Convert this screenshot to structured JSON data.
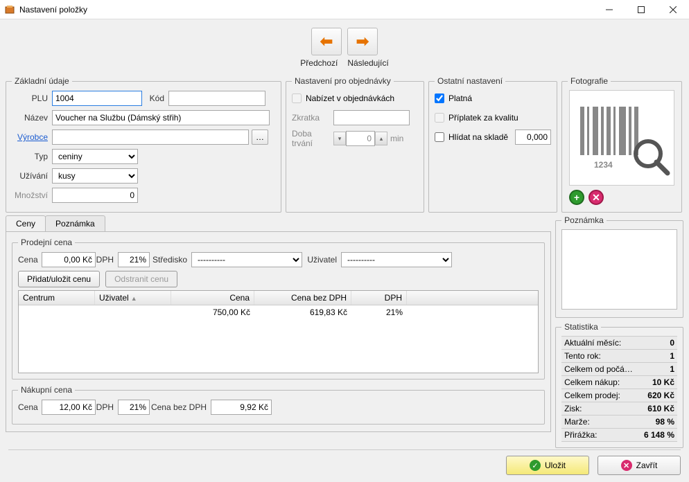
{
  "window": {
    "title": "Nastavení položky"
  },
  "toolbar": {
    "prev": "Předchozí",
    "next": "Následující"
  },
  "basic": {
    "legend": "Základní údaje",
    "plu_label": "PLU",
    "plu_value": "1004",
    "kod_label": "Kód",
    "kod_value": "",
    "nazev_label": "Název",
    "nazev_value": "Voucher na Službu (Dámský střih)",
    "vyrobce_label": "Výrobce",
    "vyrobce_value": "",
    "typ_label": "Typ",
    "typ_value": "ceniny",
    "uzivani_label": "Užívání",
    "uzivani_value": "kusy",
    "mnozstvi_label": "Množství",
    "mnozstvi_value": "0"
  },
  "orders": {
    "legend": "Nastavení pro objednávky",
    "nabizet_label": "Nabízet v objednávkách",
    "zkratka_label": "Zkratka",
    "zkratka_value": "",
    "doba_label": "Doba trvání",
    "doba_value": "0",
    "doba_unit": "min"
  },
  "other": {
    "legend": "Ostatní nastavení",
    "platna_label": "Platná",
    "priplatek_label": "Příplatek za kvalitu",
    "hlidat_label": "Hlídat na skladě",
    "hlidat_value": "0,000"
  },
  "photo": {
    "legend": "Fotografie",
    "placeholder_text": "1234"
  },
  "tabs": {
    "ceny": "Ceny",
    "poznamka": "Poznámka"
  },
  "sell": {
    "legend": "Prodejní cena",
    "cena_label": "Cena",
    "cena_value": "0,00 Kč",
    "dph_label": "DPH",
    "dph_value": "21%",
    "stredisko_label": "Středisko",
    "stredisko_value": "----------",
    "uzivatel_label": "Uživatel",
    "uzivatel_value": "----------",
    "add_btn": "Přidat/uložit cenu",
    "remove_btn": "Odstranit cenu",
    "grid_head": {
      "centrum": "Centrum",
      "uzivatel": "Uživatel",
      "cena": "Cena",
      "cena_bez": "Cena bez DPH",
      "dph": "DPH"
    },
    "grid_rows": [
      {
        "centrum": "",
        "uzivatel": "",
        "cena": "750,00 Kč",
        "cena_bez": "619,83 Kč",
        "dph": "21%"
      }
    ]
  },
  "buy": {
    "legend": "Nákupní cena",
    "cena_label": "Cena",
    "cena_value": "12,00 Kč",
    "dph_label": "DPH",
    "dph_value": "21%",
    "cena_bez_label": "Cena bez DPH",
    "cena_bez_value": "9,92 Kč"
  },
  "note": {
    "legend": "Poznámka",
    "value": ""
  },
  "stats": {
    "legend": "Statistika",
    "rows": [
      {
        "label": "Aktuální měsíc:",
        "value": "0"
      },
      {
        "label": "Tento rok:",
        "value": "1"
      },
      {
        "label": "Celkem od počá…",
        "value": "1"
      },
      {
        "label": "Celkem nákup:",
        "value": "10 Kč"
      },
      {
        "label": "Celkem prodej:",
        "value": "620 Kč"
      },
      {
        "label": "Zisk:",
        "value": "610 Kč"
      },
      {
        "label": "Marže:",
        "value": "98 %"
      },
      {
        "label": "Přirážka:",
        "value": "6 148 %"
      }
    ]
  },
  "actions": {
    "save": "Uložit",
    "close": "Zavřít"
  }
}
